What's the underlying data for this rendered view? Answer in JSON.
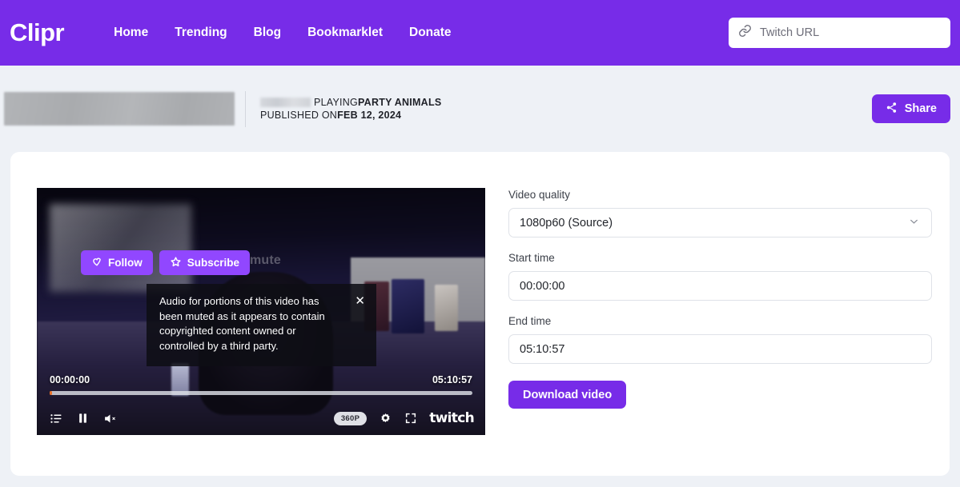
{
  "header": {
    "logo": "Clipr",
    "nav": [
      {
        "label": "Home"
      },
      {
        "label": "Trending"
      },
      {
        "label": "Blog"
      },
      {
        "label": "Bookmarklet"
      },
      {
        "label": "Donate"
      }
    ],
    "url_field": {
      "placeholder": "Twitch URL",
      "value": "",
      "icon": "link-icon"
    }
  },
  "meta": {
    "thumbnail": "blurred-video-thumbnail",
    "channel_name_redacted": "",
    "playing_prefix": "PLAYING ",
    "game_title": "PARTY ANIMALS",
    "published_prefix": "PUBLISHED ON ",
    "published_date": "FEB 12, 2024",
    "share_label": "Share",
    "share_icon": "share-nodes-icon"
  },
  "player": {
    "follow_label": "Follow",
    "follow_icon": "heart-icon",
    "subscribe_label": "Subscribe",
    "subscribe_icon": "star-icon",
    "unmute_hint": "Click to unmute",
    "notice_text": "Audio for portions of this video has been muted as it appears to contain copyrighted content owned or controlled by a third party.",
    "notice_close_icon": "close-icon",
    "current_time": "00:00:00",
    "duration": "05:10:57",
    "quality_badge": "360P",
    "controls": {
      "playlist_icon": "playlist-icon",
      "pause_icon": "pause-icon",
      "volume_muted_icon": "volume-muted-icon",
      "settings_icon": "gear-icon",
      "fullscreen_icon": "fullscreen-icon",
      "brand": "twitch"
    }
  },
  "form": {
    "quality_label": "Video quality",
    "quality_value": "1080p60 (Source)",
    "quality_chevron": "chevron-down-icon",
    "start_label": "Start time",
    "start_value": "00:00:00",
    "end_label": "End time",
    "end_value": "05:10:57",
    "download_label": "Download video"
  },
  "colors": {
    "brand_purple": "#772ce8",
    "twitch_purple": "#9147ff",
    "page_bg": "#eef1f6",
    "card_bg": "#ffffff"
  }
}
